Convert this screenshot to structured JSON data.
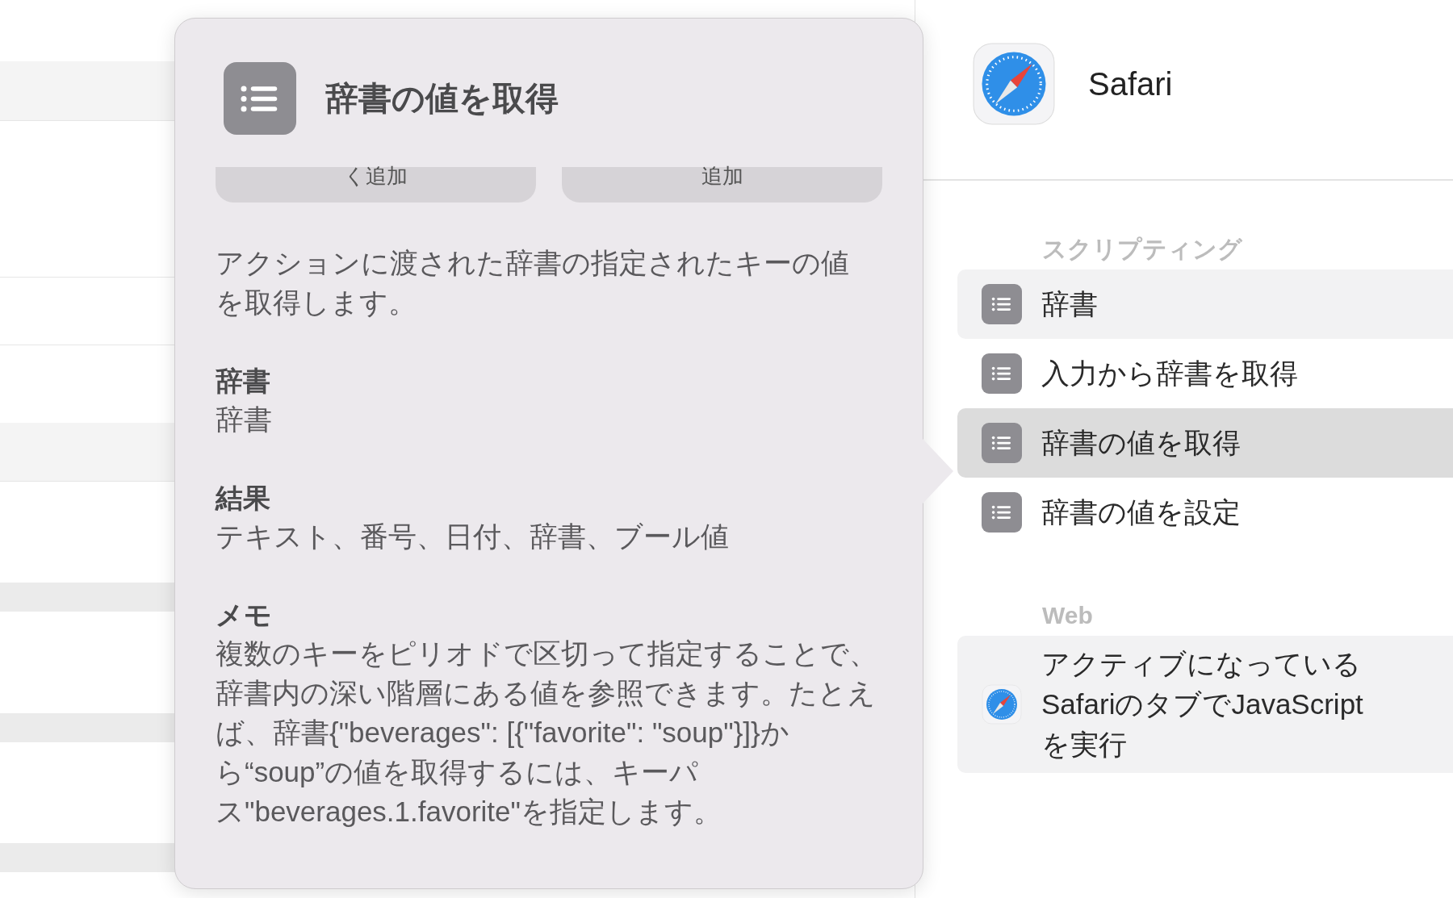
{
  "popover": {
    "title": "辞書の値を取得",
    "buttons": [
      "く追加",
      "追加"
    ],
    "description": "アクションに渡された辞書の指定されたキーの値を取得します。",
    "sections": [
      {
        "heading": "辞書",
        "body": "辞書"
      },
      {
        "heading": "結果",
        "body": "テキスト、番号、日付、辞書、ブール値"
      },
      {
        "heading": "メモ",
        "body": "複数のキーをピリオドで区切って指定することで、辞書内の深い階層にある値を参照できます。たとえば、辞書{\"beverages\": [{\"favorite\": \"soup\"}]}から“soup”の値を取得するには、キーパス\"beverages.1.favorite\"を指定します。"
      }
    ]
  },
  "sidebar": {
    "app": "Safari",
    "groups": [
      {
        "heading": "スクリプティング",
        "items": [
          {
            "label": "辞書",
            "kind": "list",
            "selected": false,
            "shaded": true
          },
          {
            "label": "入力から辞書を取得",
            "kind": "list",
            "selected": false,
            "shaded": false
          },
          {
            "label": "辞書の値を取得",
            "kind": "list",
            "selected": true,
            "shaded": false
          },
          {
            "label": "辞書の値を設定",
            "kind": "list",
            "selected": false,
            "shaded": false
          }
        ]
      },
      {
        "heading": "Web",
        "items": [
          {
            "label": "アクティブになっているSafariのタブでJavaScriptを実行",
            "kind": "safari",
            "selected": false,
            "shaded": true
          }
        ]
      }
    ]
  }
}
